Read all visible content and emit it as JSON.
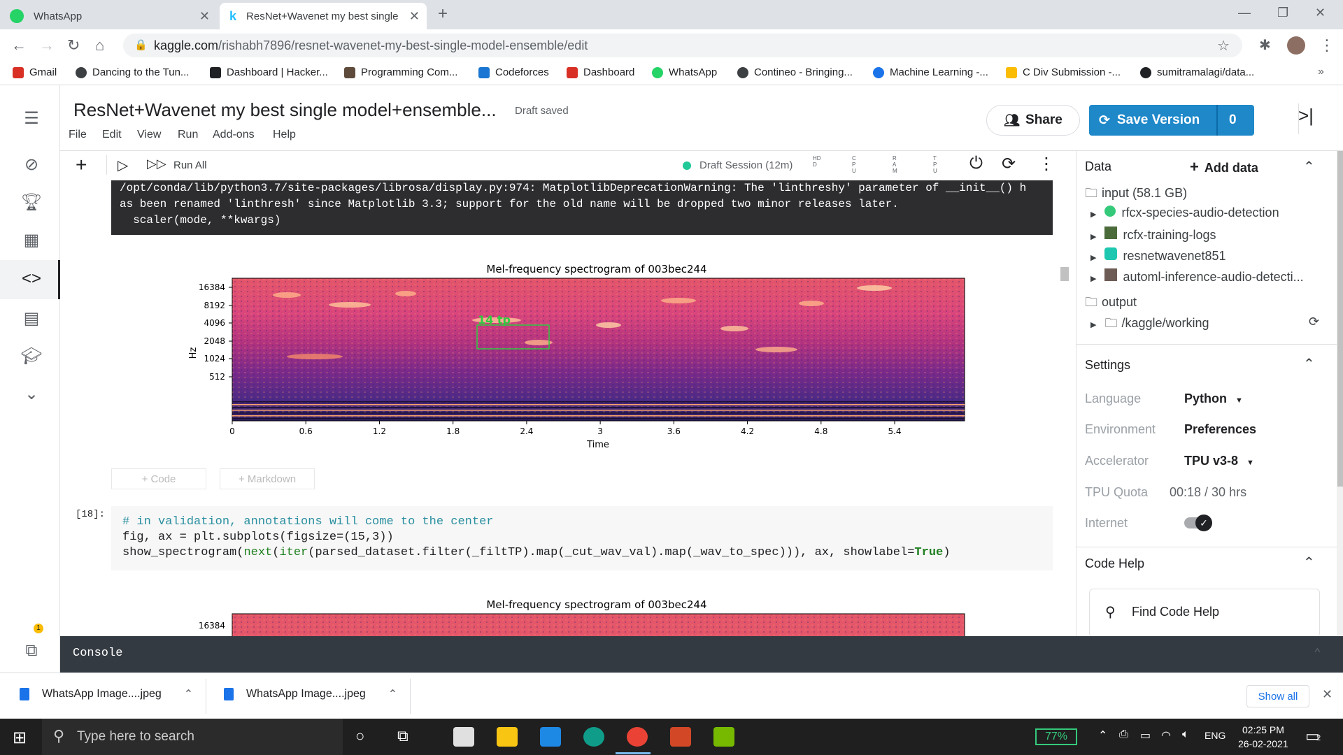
{
  "browser": {
    "tabs": [
      {
        "label": "WhatsApp"
      },
      {
        "label": "ResNet+Wavenet my best single"
      }
    ],
    "url_domain": "kaggle.com",
    "url_path": "/rishabh7896/resnet-wavenet-my-best-single-model-ensemble/edit",
    "bookmarks": [
      "Gmail",
      "Dancing to the Tun...",
      "Dashboard | Hacker...",
      "Programming Com...",
      "Codeforces",
      "Dashboard",
      "WhatsApp",
      "Contineo - Bringing...",
      "Machine Learning -...",
      "C Div Submission -...",
      "sumitramalagi/data..."
    ],
    "bookmark_colors": [
      "#d93025",
      "#3c4043",
      "#202124",
      "#3c4043",
      "#1976d2",
      "#d93025",
      "#25d366",
      "#3c4043",
      "#1a73e8",
      "#fbbc04",
      "#202124"
    ]
  },
  "notebook": {
    "title": "ResNet+Wavenet my best single model+ensemble...",
    "status": "Draft saved",
    "menus": [
      "File",
      "Edit",
      "View",
      "Run",
      "Add-ons",
      "Help"
    ],
    "share_label": "Share",
    "save_label": "Save Version",
    "save_count": "0",
    "run_all": "Run All",
    "session": "Draft Session (12m)",
    "meters": [
      "HDD",
      "CPU",
      "RAM",
      "TPU"
    ],
    "badge_count": "1"
  },
  "output": {
    "warning_lines": [
      "/opt/conda/lib/python3.7/site-packages/librosa/display.py:974: MatplotlibDeprecationWarning: The 'linthreshy' parameter of __init__() h",
      "as been renamed 'linthresh' since Matplotlib 3.3; support for the old name will be dropped two minor releases later.",
      "  scaler(mode, **kwargs)"
    ],
    "add_code": "+ Code",
    "add_markdown": "+ Markdown",
    "cell_number": "[18]:",
    "code_comment": "# in validation, annotations will come to the center",
    "code_line2": "fig, ax = plt.subplots(figsize=(15,3))",
    "code_line3_a": "show_spectrogram(",
    "code_line3_next": "next",
    "code_line3_b": "(",
    "code_line3_iter": "iter",
    "code_line3_c": "(parsed_dataset.filter(_filtTP).map(_cut_wav_val).map(_wav_to_spec))), ax, showlabel=",
    "code_line3_true": "True",
    "code_line3_d": ")"
  },
  "chart_data": [
    {
      "type": "heatmap",
      "title": "Mel-frequency spectrogram of 003bec244",
      "xlabel": "Time",
      "ylabel": "Hz",
      "x_ticks": [
        "0",
        "0.6",
        "1.2",
        "1.8",
        "2.4",
        "3",
        "3.6",
        "4.2",
        "4.8",
        "5.4"
      ],
      "y_ticks": [
        "16384",
        "8192",
        "4096",
        "2048",
        "1024",
        "512"
      ],
      "annotation": {
        "label": "14 tp",
        "color": "#2ecc40"
      }
    },
    {
      "type": "heatmap",
      "title": "Mel-frequency spectrogram of 003bec244",
      "y_ticks": [
        "16384"
      ]
    }
  ],
  "side_panel": {
    "data_title": "Data",
    "add_data": "Add data",
    "input_label": "input (58.1 GB)",
    "datasets": [
      "rfcx-species-audio-detection",
      "rcfx-training-logs",
      "resnetwavenet851",
      "automl-inference-audio-detecti..."
    ],
    "output_label": "output",
    "output_path": "/kaggle/working",
    "settings_title": "Settings",
    "settings": [
      {
        "label": "Language",
        "value": "Python"
      },
      {
        "label": "Environment",
        "value": "Preferences"
      },
      {
        "label": "Accelerator",
        "value": "TPU v3-8"
      },
      {
        "label": "TPU Quota",
        "value": "00:18 / 30 hrs"
      },
      {
        "label": "Internet",
        "value": ""
      }
    ],
    "codehelp_title": "Code Help",
    "find_code_help": "Find Code Help"
  },
  "console_label": "Console",
  "downloads": {
    "items": [
      "WhatsApp Image....jpeg",
      "WhatsApp Image....jpeg"
    ],
    "show_all": "Show all"
  },
  "taskbar": {
    "search_placeholder": "Type here to search",
    "battery": "77%",
    "lang": "ENG",
    "time": "02:25 PM",
    "date": "26-02-2021",
    "notif_count": "2"
  }
}
